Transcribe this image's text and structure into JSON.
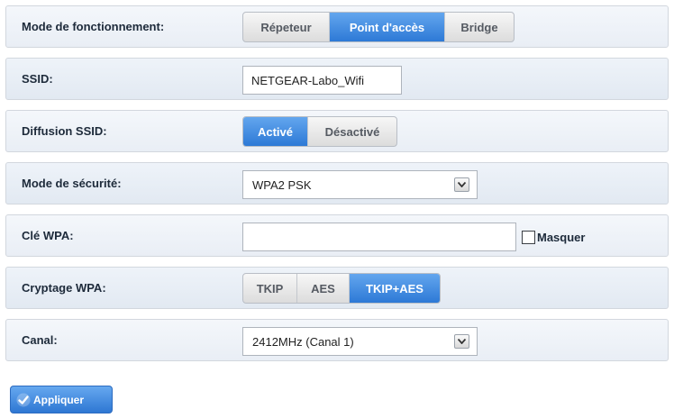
{
  "fields": {
    "mode": {
      "label": "Mode de fonctionnement:",
      "options": [
        "Répeteur",
        "Point d'accès",
        "Bridge"
      ],
      "selected": "Point d'accès"
    },
    "ssid": {
      "label": "SSID:",
      "value": "NETGEAR-Labo_Wifi"
    },
    "broadcast": {
      "label": "Diffusion SSID:",
      "options": [
        "Activé",
        "Désactivé"
      ],
      "selected": "Activé"
    },
    "security": {
      "label": "Mode de sécurité:",
      "value": "WPA2 PSK"
    },
    "wpa_key": {
      "label": "Clé WPA:",
      "value": "",
      "mask_label": "Masquer",
      "mask_checked": false
    },
    "encryption": {
      "label": "Cryptage WPA:",
      "options": [
        "TKIP",
        "AES",
        "TKIP+AES"
      ],
      "selected": "TKIP+AES"
    },
    "channel": {
      "label": "Canal:",
      "value": "2412MHz (Canal 1)"
    }
  },
  "apply_label": "Appliquer",
  "colors": {
    "accent": "#2d79d6",
    "row_border": "#d2d7de",
    "label_text": "#1d2a3a"
  },
  "icons": {
    "dropdown": "chevron-down-icon",
    "apply": "checkmark-icon"
  }
}
